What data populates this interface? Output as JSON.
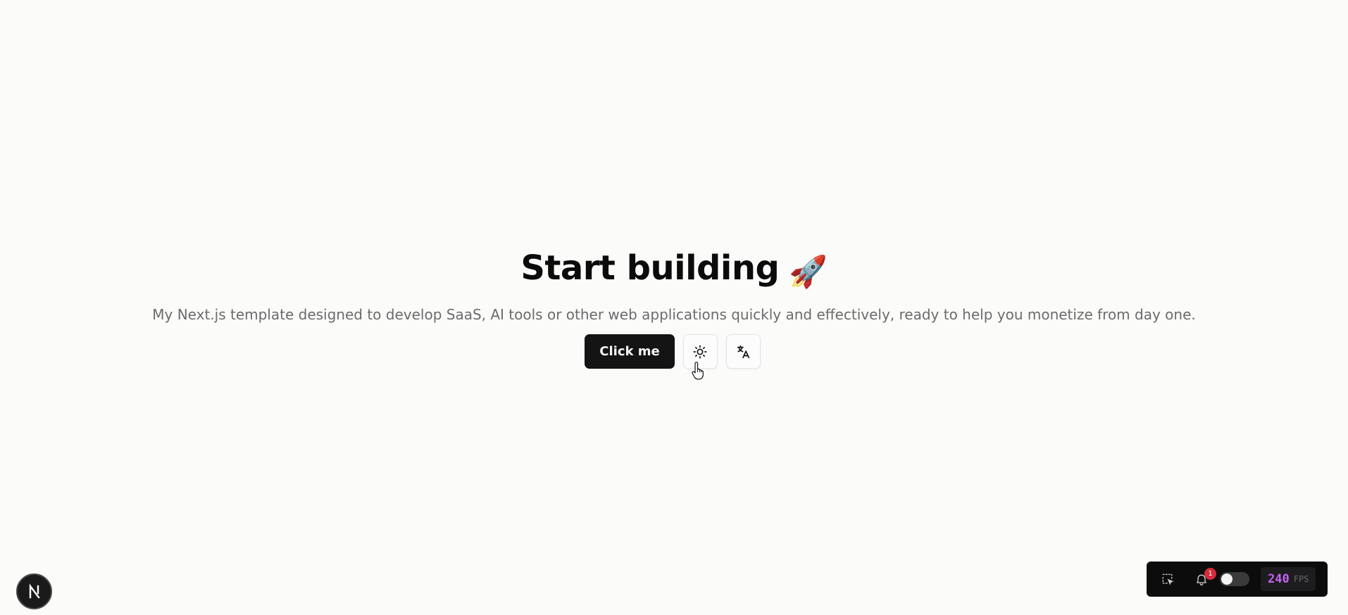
{
  "hero": {
    "title": "Start building",
    "title_emoji": "🚀",
    "subtitle": "My Next.js template designed to develop SaaS, AI tools or other web applications quickly and effectively, ready to help you monetize from day one."
  },
  "actions": {
    "primary_label": "Click me",
    "theme_icon": "sun-icon",
    "language_icon": "translate-icon"
  },
  "next_badge": {
    "letter": "N"
  },
  "devbar": {
    "select_icon": "inspect-select-icon",
    "notifications_icon": "bell-icon",
    "notifications_count": "1",
    "toggle_state": "off",
    "fps_value": "240",
    "fps_label": "FPS",
    "fps_color": "#c163f4"
  },
  "colors": {
    "background": "#fbfbfa",
    "primary_button": "#141414",
    "notification_badge": "#d62b3c"
  }
}
